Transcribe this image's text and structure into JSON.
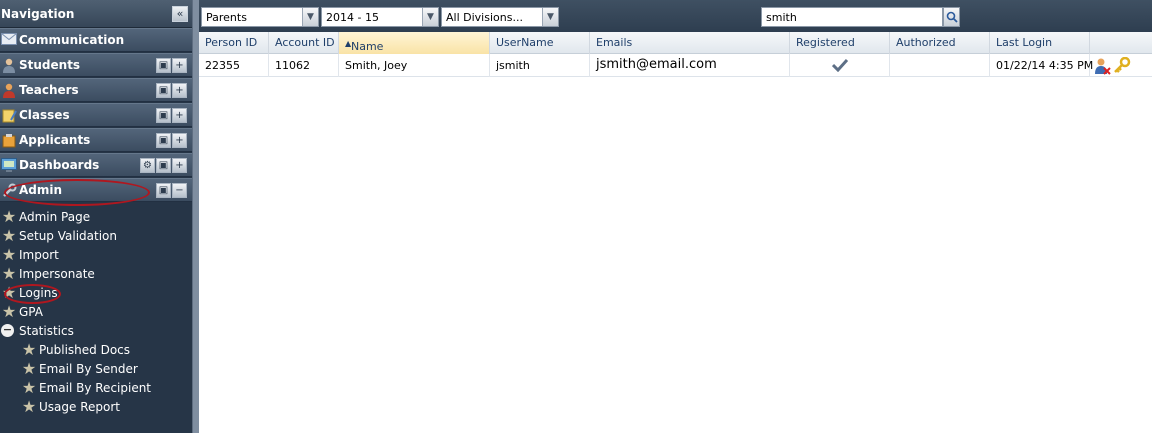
{
  "navigation": {
    "title": "Navigation",
    "collapse_glyph": "«",
    "sections": [
      {
        "label": "Communication",
        "icon": "envelope-icon"
      },
      {
        "label": "Students",
        "icon": "student-icon"
      },
      {
        "label": "Teachers",
        "icon": "teacher-icon"
      },
      {
        "label": "Classes",
        "icon": "classes-icon"
      },
      {
        "label": "Applicants",
        "icon": "applicants-icon"
      },
      {
        "label": "Dashboards",
        "icon": "dashboard-icon"
      },
      {
        "label": "Admin",
        "icon": "wrench-icon"
      }
    ],
    "admin_items": [
      {
        "label": "Admin Page"
      },
      {
        "label": "Setup Validation"
      },
      {
        "label": "Import"
      },
      {
        "label": "Impersonate"
      },
      {
        "label": "Logins"
      },
      {
        "label": "GPA"
      },
      {
        "label": "Statistics"
      }
    ],
    "statistics_items": [
      {
        "label": "Published Docs"
      },
      {
        "label": "Email By Sender"
      },
      {
        "label": "Email By Recipient"
      },
      {
        "label": "Usage Report"
      }
    ]
  },
  "toolbar": {
    "type_select": "Parents",
    "year_select": "2014 - 15",
    "division_select": "All Divisions...",
    "search_value": "smith"
  },
  "grid": {
    "columns": [
      "Person ID",
      "Account ID",
      "Name",
      "UserName",
      "Emails",
      "Registered",
      "Authorized",
      "Last Login"
    ],
    "sort_indicator": "▲",
    "rows": [
      {
        "person_id": "22355",
        "account_id": "11062",
        "name": "Smith, Joey",
        "username": "jsmith",
        "email": "jsmith@email.com",
        "registered": true,
        "authorized": "",
        "last_login": "01/22/14 4:35 PM"
      }
    ]
  },
  "colors": {
    "sidebar_bg": "#263547",
    "toolbar_bg": "#2e3e50",
    "highlight_circle": "#b0171f",
    "sorted_header": "#f9e3a6"
  }
}
